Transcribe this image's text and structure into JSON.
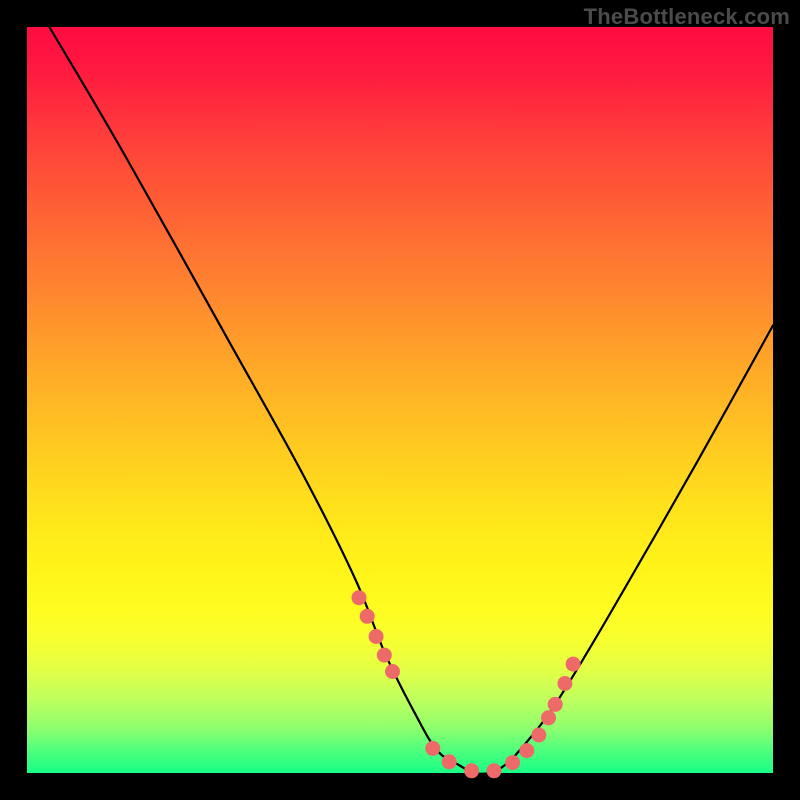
{
  "attribution": "TheBottleneck.com",
  "colors": {
    "page_bg": "#000000",
    "curve_stroke": "#000000",
    "dot_fill": "#ed6a69",
    "gradient_top": "#ff0b42",
    "gradient_bottom": "#18ff86"
  },
  "chart_data": {
    "type": "line",
    "title": "",
    "xlabel": "",
    "ylabel": "",
    "xlim": [
      0,
      100
    ],
    "ylim": [
      0,
      100
    ],
    "grid": false,
    "legend": false,
    "series": [
      {
        "name": "bottleneck-curve",
        "x": [
          3,
          13,
          27,
          37,
          44,
          48,
          52,
          55,
          58,
          60,
          62,
          64,
          66,
          70,
          75,
          82,
          90,
          100
        ],
        "y": [
          100,
          83,
          58,
          40,
          26,
          16,
          8,
          3,
          1,
          0,
          0,
          1,
          3,
          8,
          16,
          28,
          42,
          60
        ]
      }
    ],
    "highlight_points": {
      "name": "dots",
      "x": [
        44.5,
        45.6,
        46.8,
        47.9,
        49.0,
        54.4,
        56.6,
        59.6,
        62.6,
        65.1,
        67.0,
        68.6,
        69.9,
        70.8,
        72.1,
        73.2
      ],
      "y": [
        23.5,
        21.0,
        18.3,
        15.8,
        13.6,
        3.3,
        1.5,
        0.3,
        0.3,
        1.4,
        3.0,
        5.1,
        7.4,
        9.2,
        12.0,
        14.6
      ]
    }
  }
}
